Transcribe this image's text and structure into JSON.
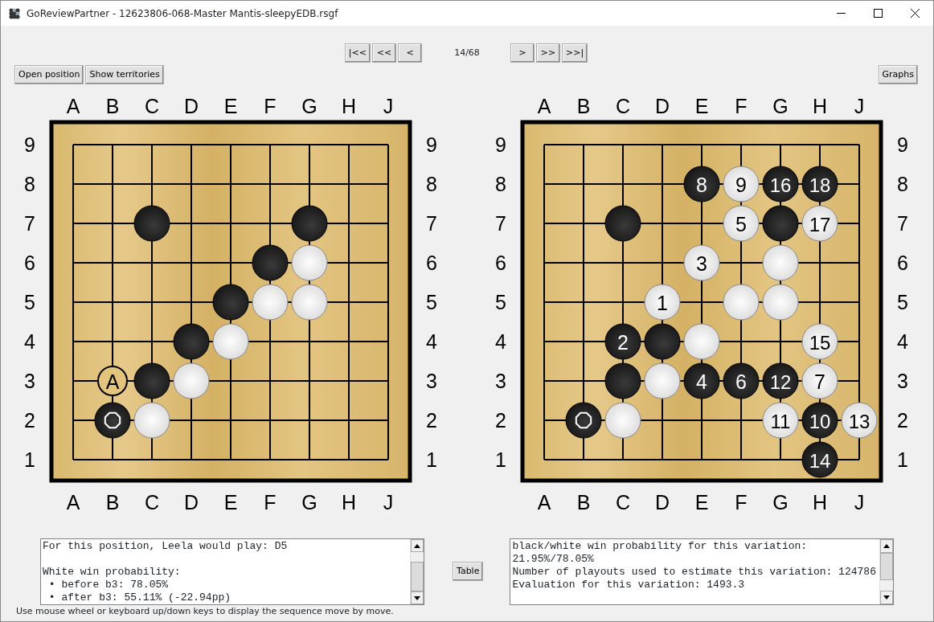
{
  "window": {
    "title": "GoReviewPartner - 12623806-068-Master Mantis-sleepyEDB.rsgf"
  },
  "navigation": {
    "back_buttons": [
      "|<<",
      "<<",
      "<"
    ],
    "move_counter": "14/68",
    "forward_buttons": [
      ">",
      ">>",
      ">>|"
    ]
  },
  "left_buttons": [
    "Open position",
    "Show territories"
  ],
  "right_button": "Graphs",
  "boards": [
    {
      "top_labels": [
        "A",
        "B",
        "C",
        "D",
        "E",
        "F",
        "G",
        "H",
        "J"
      ],
      "left_labels": [
        "9",
        "8",
        "7",
        "6",
        "5",
        "4",
        "3",
        "2",
        "1"
      ],
      "right_labels": [
        "9",
        "8",
        "7",
        "6",
        "5",
        "4",
        "3",
        "2",
        "1"
      ],
      "bottom_labels": [
        "A",
        "B",
        "C",
        "D",
        "E",
        "F",
        "G",
        "H",
        "J"
      ],
      "points": [
        [
          {
            "kind": "empty"
          },
          {
            "kind": "empty"
          },
          {
            "kind": "empty"
          },
          {
            "kind": "empty"
          },
          {
            "kind": "empty"
          },
          {
            "kind": "empty"
          },
          {
            "kind": "empty"
          },
          {
            "kind": "empty"
          },
          {
            "kind": "empty"
          }
        ],
        [
          {
            "kind": "empty"
          },
          {
            "kind": "empty"
          },
          {
            "kind": "empty"
          },
          {
            "kind": "empty"
          },
          {
            "kind": "empty"
          },
          {
            "kind": "empty"
          },
          {
            "kind": "empty"
          },
          {
            "kind": "empty"
          },
          {
            "kind": "empty"
          }
        ],
        [
          {
            "kind": "empty"
          },
          {
            "kind": "empty"
          },
          {
            "kind": "black"
          },
          {
            "kind": "empty"
          },
          {
            "kind": "empty"
          },
          {
            "kind": "empty"
          },
          {
            "kind": "black"
          },
          {
            "kind": "empty"
          },
          {
            "kind": "empty"
          }
        ],
        [
          {
            "kind": "empty"
          },
          {
            "kind": "empty"
          },
          {
            "kind": "empty"
          },
          {
            "kind": "empty"
          },
          {
            "kind": "empty"
          },
          {
            "kind": "black"
          },
          {
            "kind": "white"
          },
          {
            "kind": "empty"
          },
          {
            "kind": "empty"
          }
        ],
        [
          {
            "kind": "empty"
          },
          {
            "kind": "empty"
          },
          {
            "kind": "empty"
          },
          {
            "kind": "empty"
          },
          {
            "kind": "black"
          },
          {
            "kind": "white"
          },
          {
            "kind": "white"
          },
          {
            "kind": "empty"
          },
          {
            "kind": "empty"
          }
        ],
        [
          {
            "kind": "empty"
          },
          {
            "kind": "empty"
          },
          {
            "kind": "empty"
          },
          {
            "kind": "black"
          },
          {
            "kind": "white"
          },
          {
            "kind": "empty"
          },
          {
            "kind": "empty"
          },
          {
            "kind": "empty"
          },
          {
            "kind": "empty"
          }
        ],
        [
          {
            "kind": "empty"
          },
          {
            "kind": "mark",
            "label": "A"
          },
          {
            "kind": "black"
          },
          {
            "kind": "white"
          },
          {
            "kind": "empty"
          },
          {
            "kind": "empty"
          },
          {
            "kind": "empty"
          },
          {
            "kind": "empty"
          },
          {
            "kind": "empty"
          }
        ],
        [
          {
            "kind": "empty"
          },
          {
            "kind": "last_black"
          },
          {
            "kind": "white"
          },
          {
            "kind": "empty"
          },
          {
            "kind": "empty"
          },
          {
            "kind": "empty"
          },
          {
            "kind": "empty"
          },
          {
            "kind": "empty"
          },
          {
            "kind": "empty"
          }
        ],
        [
          {
            "kind": "empty"
          },
          {
            "kind": "empty"
          },
          {
            "kind": "empty"
          },
          {
            "kind": "empty"
          },
          {
            "kind": "empty"
          },
          {
            "kind": "empty"
          },
          {
            "kind": "empty"
          },
          {
            "kind": "empty"
          },
          {
            "kind": "empty"
          }
        ]
      ]
    },
    {
      "top_labels": [
        "A",
        "B",
        "C",
        "D",
        "E",
        "F",
        "G",
        "H",
        "J"
      ],
      "left_labels": [
        "9",
        "8",
        "7",
        "6",
        "5",
        "4",
        "3",
        "2",
        "1"
      ],
      "right_labels": [
        "9",
        "8",
        "7",
        "6",
        "5",
        "4",
        "3",
        "2",
        "1"
      ],
      "bottom_labels": [
        "A",
        "B",
        "C",
        "D",
        "E",
        "F",
        "G",
        "H",
        "J"
      ],
      "points": [
        [
          {
            "kind": "empty"
          },
          {
            "kind": "empty"
          },
          {
            "kind": "empty"
          },
          {
            "kind": "empty"
          },
          {
            "kind": "empty"
          },
          {
            "kind": "empty"
          },
          {
            "kind": "empty"
          },
          {
            "kind": "empty"
          },
          {
            "kind": "empty"
          }
        ],
        [
          {
            "kind": "empty"
          },
          {
            "kind": "empty"
          },
          {
            "kind": "empty"
          },
          {
            "kind": "empty"
          },
          {
            "kind": "black",
            "label": "8"
          },
          {
            "kind": "white",
            "label": "9"
          },
          {
            "kind": "black",
            "label": "16"
          },
          {
            "kind": "black",
            "label": "18"
          },
          {
            "kind": "empty"
          }
        ],
        [
          {
            "kind": "empty"
          },
          {
            "kind": "empty"
          },
          {
            "kind": "black"
          },
          {
            "kind": "empty"
          },
          {
            "kind": "empty"
          },
          {
            "kind": "white",
            "label": "5"
          },
          {
            "kind": "black"
          },
          {
            "kind": "white",
            "label": "17"
          },
          {
            "kind": "empty"
          }
        ],
        [
          {
            "kind": "empty"
          },
          {
            "kind": "empty"
          },
          {
            "kind": "empty"
          },
          {
            "kind": "empty"
          },
          {
            "kind": "white",
            "label": "3"
          },
          {
            "kind": "empty"
          },
          {
            "kind": "white"
          },
          {
            "kind": "empty"
          },
          {
            "kind": "empty"
          }
        ],
        [
          {
            "kind": "empty"
          },
          {
            "kind": "empty"
          },
          {
            "kind": "empty"
          },
          {
            "kind": "white",
            "label": "1"
          },
          {
            "kind": "empty"
          },
          {
            "kind": "white"
          },
          {
            "kind": "white"
          },
          {
            "kind": "empty"
          },
          {
            "kind": "empty"
          }
        ],
        [
          {
            "kind": "empty"
          },
          {
            "kind": "empty"
          },
          {
            "kind": "black",
            "label": "2"
          },
          {
            "kind": "black"
          },
          {
            "kind": "white"
          },
          {
            "kind": "empty"
          },
          {
            "kind": "empty"
          },
          {
            "kind": "white",
            "label": "15"
          },
          {
            "kind": "empty"
          }
        ],
        [
          {
            "kind": "empty"
          },
          {
            "kind": "empty"
          },
          {
            "kind": "black"
          },
          {
            "kind": "white"
          },
          {
            "kind": "black",
            "label": "4"
          },
          {
            "kind": "black",
            "label": "6"
          },
          {
            "kind": "black",
            "label": "12"
          },
          {
            "kind": "white",
            "label": "7"
          },
          {
            "kind": "empty"
          }
        ],
        [
          {
            "kind": "empty"
          },
          {
            "kind": "last_black"
          },
          {
            "kind": "white"
          },
          {
            "kind": "empty"
          },
          {
            "kind": "empty"
          },
          {
            "kind": "empty"
          },
          {
            "kind": "white",
            "label": "11"
          },
          {
            "kind": "black",
            "label": "10"
          },
          {
            "kind": "white",
            "label": "13"
          }
        ],
        [
          {
            "kind": "empty"
          },
          {
            "kind": "empty"
          },
          {
            "kind": "empty"
          },
          {
            "kind": "empty"
          },
          {
            "kind": "empty"
          },
          {
            "kind": "empty"
          },
          {
            "kind": "empty"
          },
          {
            "kind": "black",
            "label": "14"
          },
          {
            "kind": "empty"
          }
        ]
      ]
    }
  ],
  "left_text": [
    [
      "For this position, Leela would play: D5"
    ],
    [
      "White win probability:",
      " • before b3: 78.05%",
      " • after b3: 55.11% (-22.94pp)"
    ]
  ],
  "middle_button": "Table",
  "right_text": [
    [
      "black/white win probability for this variation: 21.95%/78.05%",
      "Number of playouts used to estimate this variation: 124786",
      "Evaluation for this variation: 1493.3"
    ]
  ],
  "status_bar": "Use mouse wheel or keyboard up/down keys to display the sequence move by move."
}
